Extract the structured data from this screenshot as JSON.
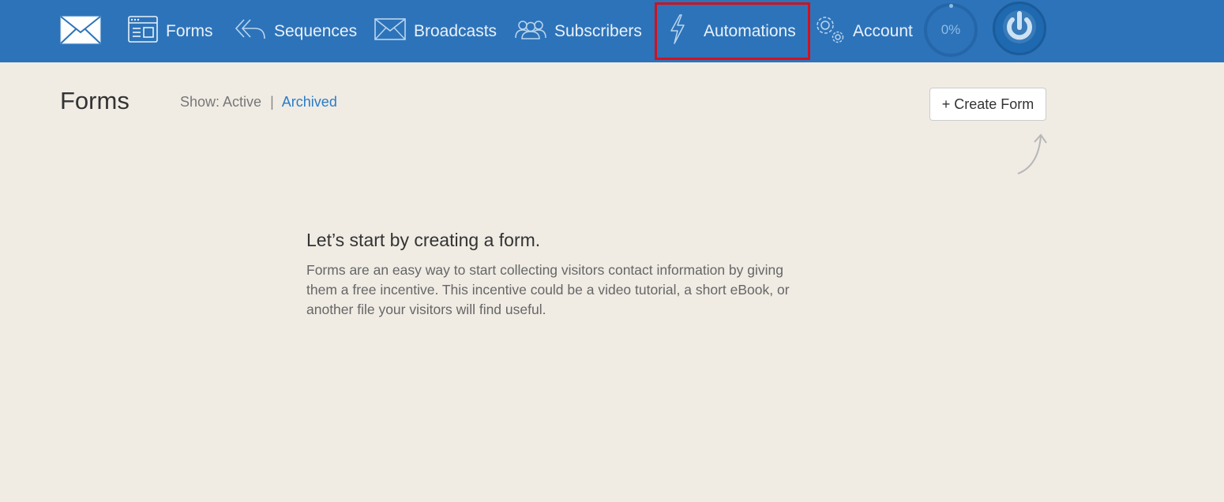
{
  "nav": {
    "forms": "Forms",
    "sequences": "Sequences",
    "broadcasts": "Broadcasts",
    "subscribers": "Subscribers",
    "automations": "Automations",
    "account": "Account",
    "progress": "0%"
  },
  "page": {
    "title": "Forms",
    "show_label": "Show:",
    "active_option": "Active",
    "separator": "|",
    "archived_option": "Archived",
    "create_button": "+ Create Form"
  },
  "empty_state": {
    "heading": "Let’s start by creating a form.",
    "text": "Forms are an easy way to start collecting visitors contact information by giving them a free incentive. This incentive could be a video tutorial, a short eBook, or another file your visitors will find useful."
  },
  "icons": {
    "logo": "envelope-icon",
    "forms": "form-window-icon",
    "sequences": "reply-all-icon",
    "broadcasts": "envelope-icon",
    "subscribers": "users-icon",
    "automations": "lightning-icon",
    "account": "gears-icon",
    "power": "power-icon"
  },
  "colors": {
    "topbar": "#2d73b9",
    "highlight_border": "#d0121f",
    "link": "#2a7cc7",
    "background": "#f0ece4"
  }
}
